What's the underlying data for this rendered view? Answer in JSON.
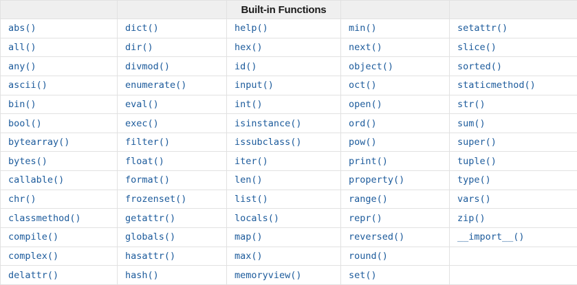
{
  "header": {
    "title": "Built-in Functions"
  },
  "colors": {
    "link": "#1b5a9b",
    "border": "#e1e1e1",
    "header_bg": "#efefef",
    "header_text": "#1a1a1a",
    "page_bg": "#ffffff"
  },
  "table": {
    "column_count": 5,
    "rows": [
      [
        "abs()",
        "dict()",
        "help()",
        "min()",
        "setattr()"
      ],
      [
        "all()",
        "dir()",
        "hex()",
        "next()",
        "slice()"
      ],
      [
        "any()",
        "divmod()",
        "id()",
        "object()",
        "sorted()"
      ],
      [
        "ascii()",
        "enumerate()",
        "input()",
        "oct()",
        "staticmethod()"
      ],
      [
        "bin()",
        "eval()",
        "int()",
        "open()",
        "str()"
      ],
      [
        "bool()",
        "exec()",
        "isinstance()",
        "ord()",
        "sum()"
      ],
      [
        "bytearray()",
        "filter()",
        "issubclass()",
        "pow()",
        "super()"
      ],
      [
        "bytes()",
        "float()",
        "iter()",
        "print()",
        "tuple()"
      ],
      [
        "callable()",
        "format()",
        "len()",
        "property()",
        "type()"
      ],
      [
        "chr()",
        "frozenset()",
        "list()",
        "range()",
        "vars()"
      ],
      [
        "classmethod()",
        "getattr()",
        "locals()",
        "repr()",
        "zip()"
      ],
      [
        "compile()",
        "globals()",
        "map()",
        "reversed()",
        "__import__()"
      ],
      [
        "complex()",
        "hasattr()",
        "max()",
        "round()",
        ""
      ],
      [
        "delattr()",
        "hash()",
        "memoryview()",
        "set()",
        ""
      ]
    ]
  }
}
